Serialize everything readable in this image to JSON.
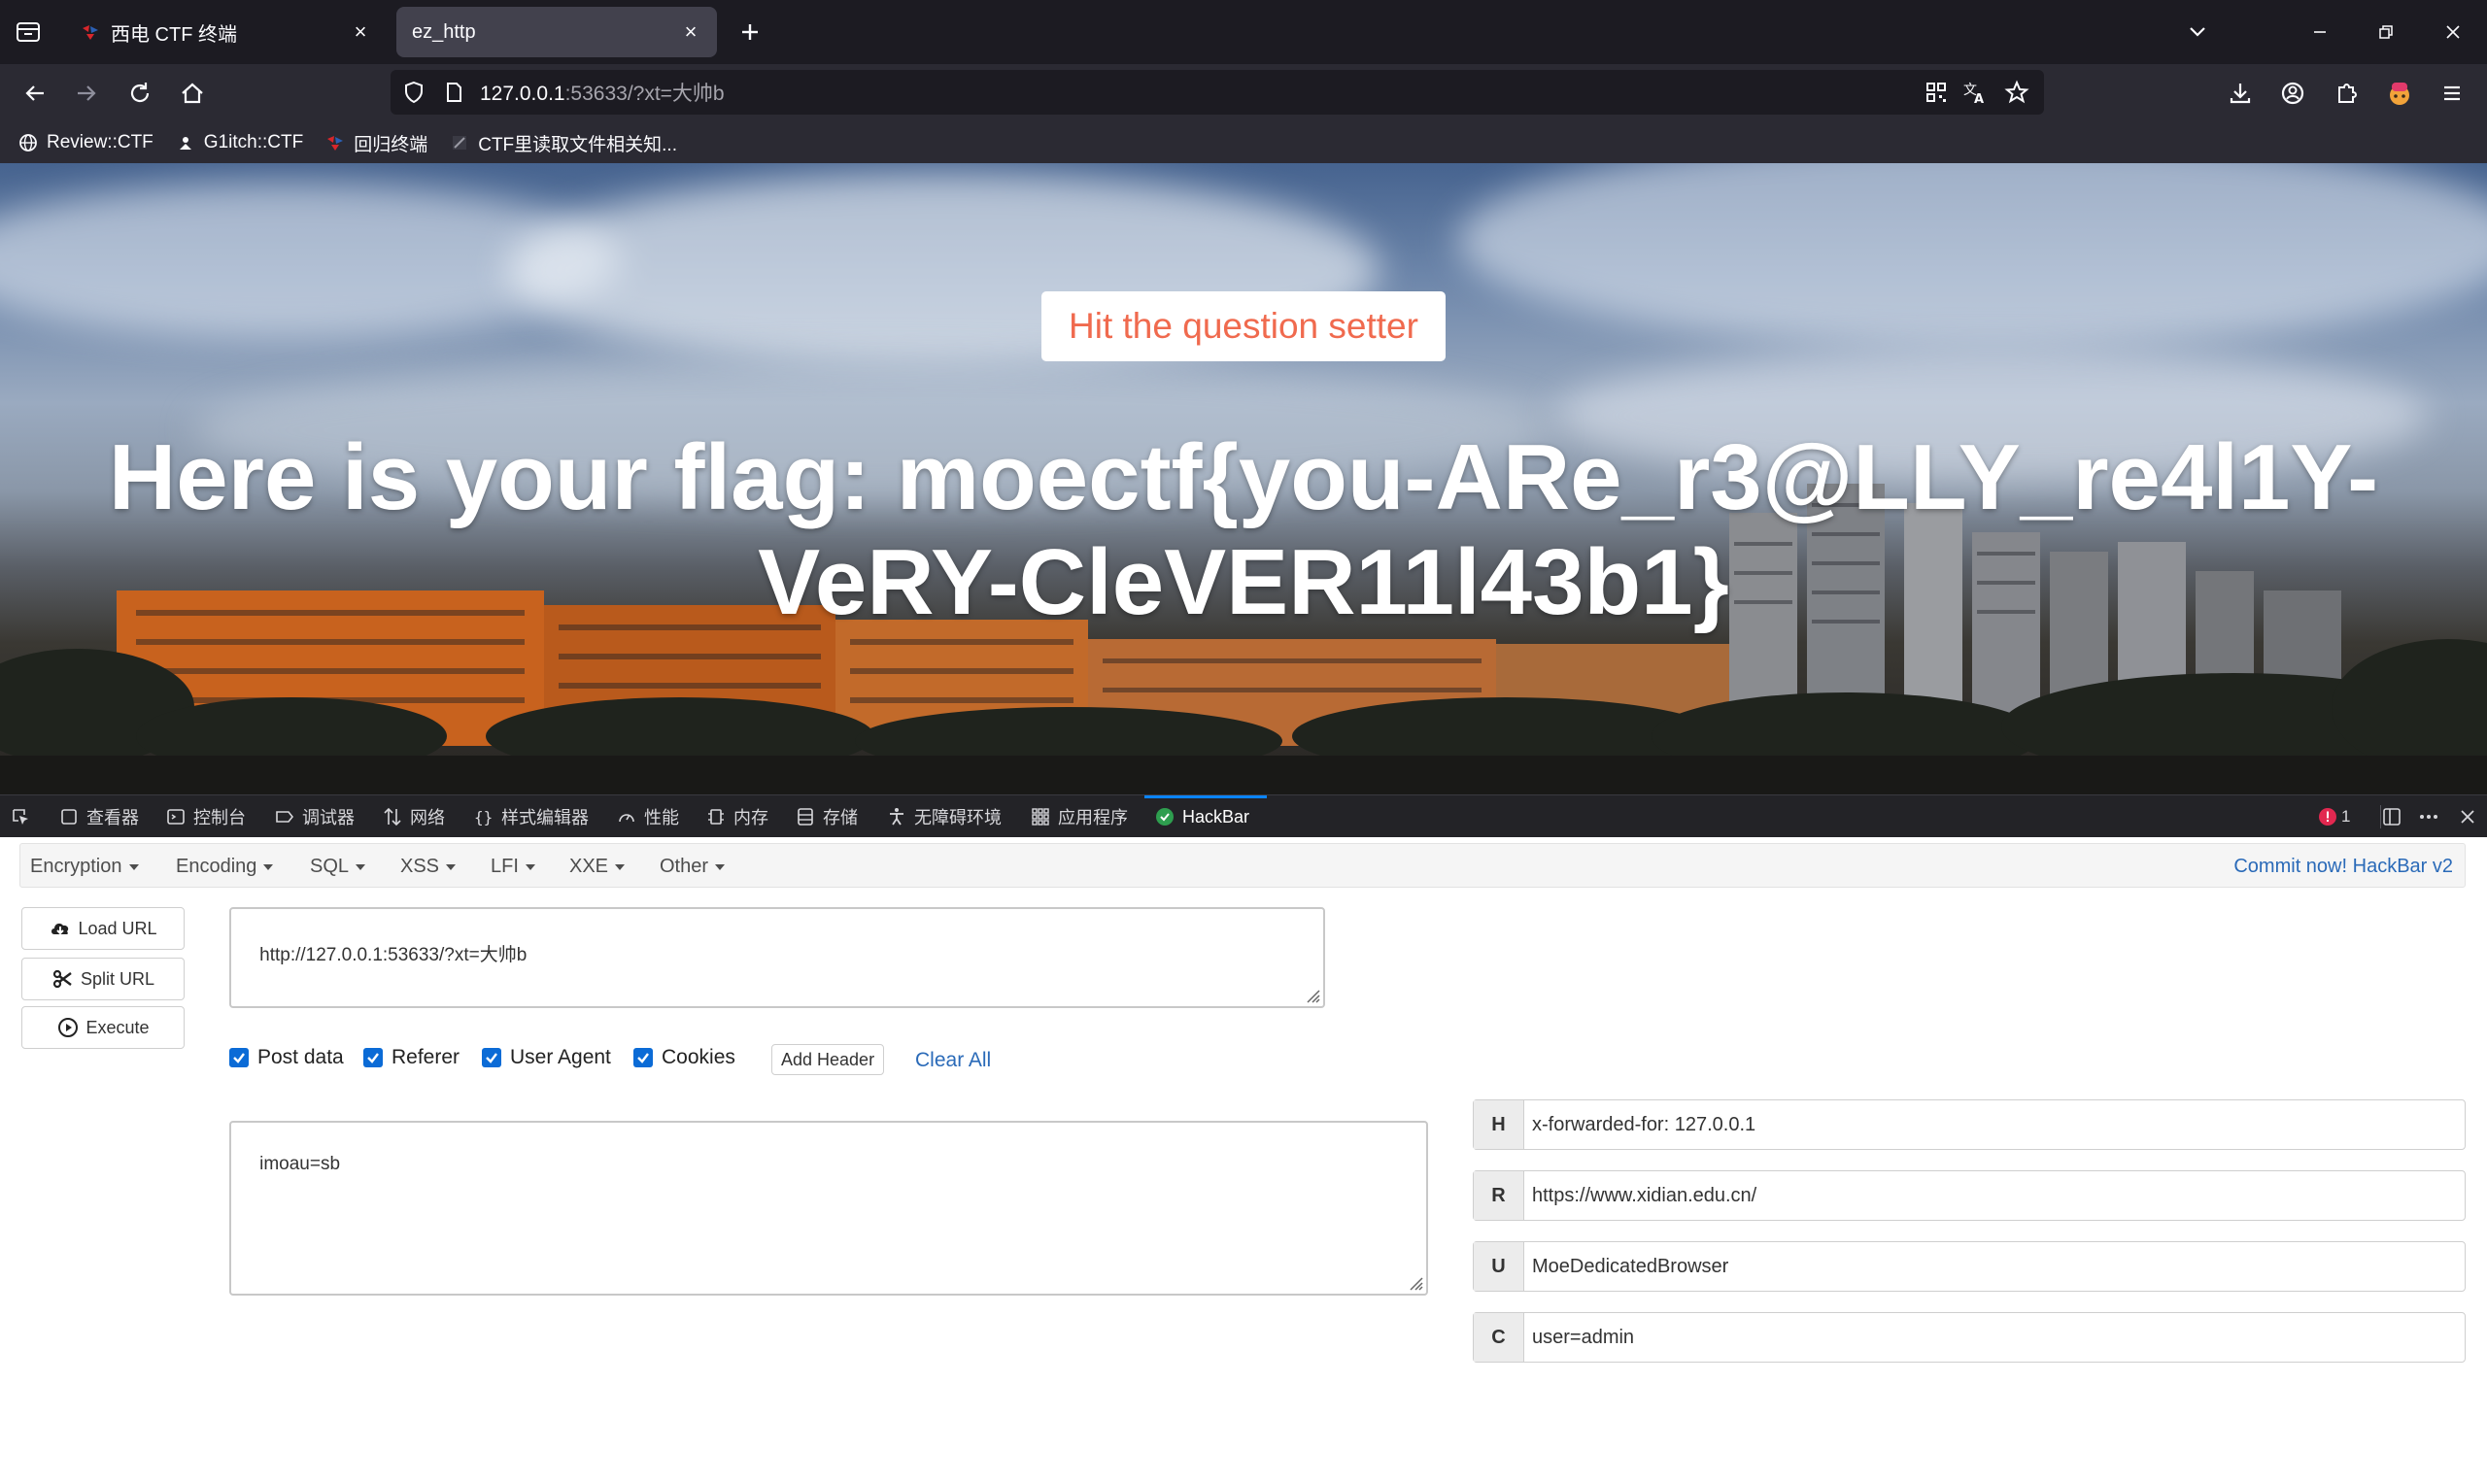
{
  "browser": {
    "tabs": [
      {
        "title": "西电 CTF 终端",
        "active": false
      },
      {
        "title": "ez_http",
        "active": true
      }
    ],
    "url": {
      "host": "127.0.0.1",
      "rest": ":53633/?xt=大帅b"
    },
    "bookmarks": [
      {
        "label": "Review::CTF",
        "icon": "globe-icon"
      },
      {
        "label": "G1itch::CTF",
        "icon": "figure-icon"
      },
      {
        "label": "回归终端",
        "icon": "red-logo-icon"
      },
      {
        "label": "CTF里读取文件相关知...",
        "icon": "site-icon"
      }
    ]
  },
  "page": {
    "button_label": "Hit the question setter",
    "flag_text": "Here is your flag: moectf{you-ARe_r3@LLY_re4l1Y-VeRY-CleVER11l43b1}"
  },
  "devtools": {
    "tabs": [
      {
        "label": "查看器",
        "icon": "inspector-icon"
      },
      {
        "label": "控制台",
        "icon": "console-icon"
      },
      {
        "label": "调试器",
        "icon": "debugger-icon"
      },
      {
        "label": "网络",
        "icon": "network-icon"
      },
      {
        "label": "样式编辑器",
        "icon": "style-editor-icon"
      },
      {
        "label": "性能",
        "icon": "performance-icon"
      },
      {
        "label": "内存",
        "icon": "memory-icon"
      },
      {
        "label": "存储",
        "icon": "storage-icon"
      },
      {
        "label": "无障碍环境",
        "icon": "accessibility-icon"
      },
      {
        "label": "应用程序",
        "icon": "application-icon"
      },
      {
        "label": "HackBar",
        "icon": "hackbar-icon"
      }
    ],
    "error_count": "1"
  },
  "hackbar": {
    "menus": [
      "Encryption",
      "Encoding",
      "SQL",
      "XSS",
      "LFI",
      "XXE",
      "Other"
    ],
    "commit_link": "Commit now!",
    "version": "HackBar v2",
    "buttons": {
      "load_url": "Load URL",
      "split_url": "Split URL",
      "execute": "Execute"
    },
    "url_value": "http://127.0.0.1:53633/?xt=大帅b",
    "options": [
      {
        "label": "Post data",
        "checked": true
      },
      {
        "label": "Referer",
        "checked": true
      },
      {
        "label": "User Agent",
        "checked": true
      },
      {
        "label": "Cookies",
        "checked": true
      }
    ],
    "add_header": "Add Header",
    "clear_all": "Clear All",
    "post_body": "imoau=sb",
    "headers": [
      {
        "key": "H",
        "value": "x-forwarded-for: 127.0.0.1"
      },
      {
        "key": "R",
        "value": "https://www.xidian.edu.cn/"
      },
      {
        "key": "U",
        "value": "MoeDedicatedBrowser"
      },
      {
        "key": "C",
        "value": "user=admin"
      }
    ]
  },
  "colors": {
    "accent_blue": "#0a84ff",
    "button_text_orange": "#f06a4e",
    "link_blue": "#2a6ab8",
    "checkbox_blue": "#0b6bd6"
  }
}
